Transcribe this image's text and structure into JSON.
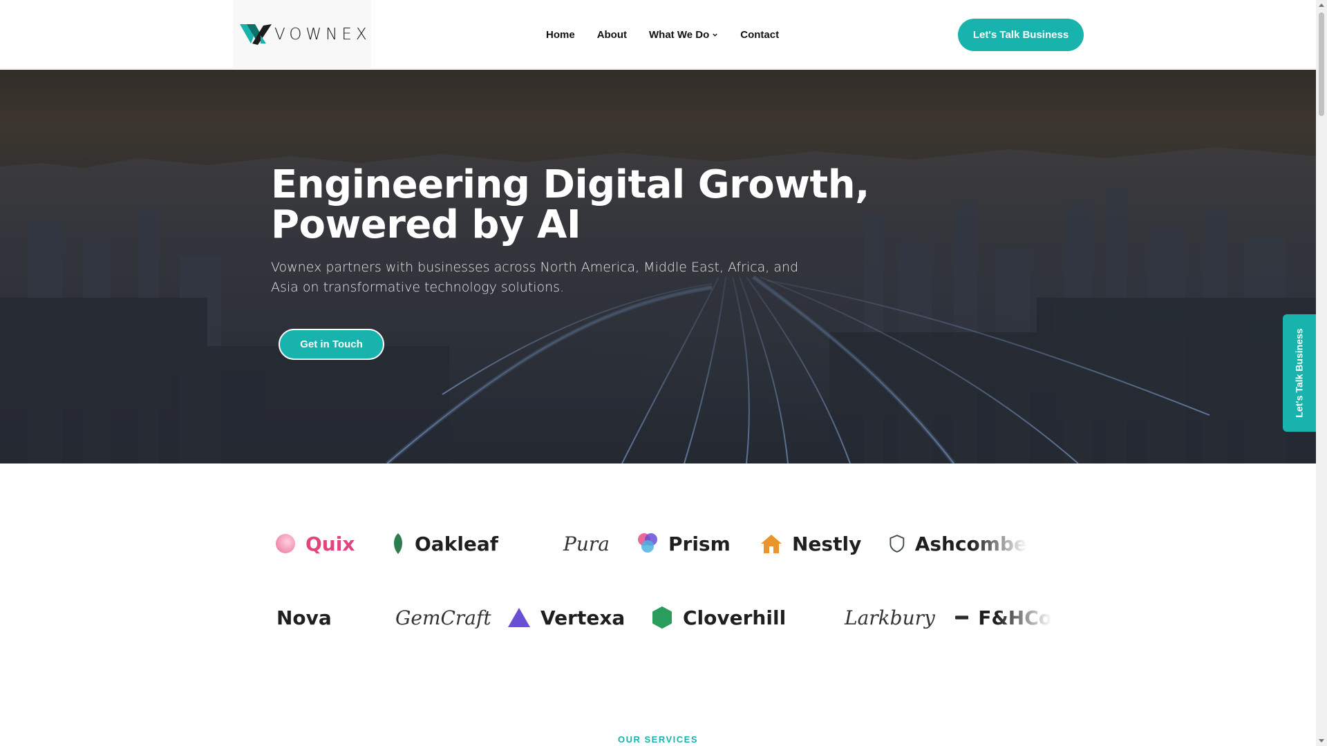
{
  "header": {
    "logo_text": "VOWNEX",
    "nav": [
      {
        "label": "Home"
      },
      {
        "label": "About"
      },
      {
        "label": "What We Do"
      },
      {
        "label": "Contact"
      }
    ],
    "cta_label": "Let's Talk Business"
  },
  "hero": {
    "title_line1": "Engineering Digital Growth,",
    "title_line2": "Powered by AI",
    "subtitle": "Vownex partners with businesses across North America, Middle East, Africa, and Asia on transformative technology solutions.",
    "cta_label": "Get in Touch"
  },
  "side_tab": {
    "label": "Let's Talk Business"
  },
  "logos": {
    "row1": [
      {
        "name": "Quix",
        "icon": "pink-circle-icon"
      },
      {
        "name": "Oakleaf",
        "icon": "leaf-icon"
      },
      {
        "name": "Pura",
        "icon": "none"
      },
      {
        "name": "Prism",
        "icon": "prism-circles-icon"
      },
      {
        "name": "Nestly",
        "icon": "house-icon"
      },
      {
        "name": "Ashcombe",
        "icon": "shield-icon"
      }
    ],
    "row2": [
      {
        "name": "Nova",
        "icon": "none"
      },
      {
        "name": "GemCraft",
        "icon": "none"
      },
      {
        "name": "Vertexa",
        "icon": "triangle-icon"
      },
      {
        "name": "Cloverhill",
        "icon": "hexagon-icon"
      },
      {
        "name": "Larkbury",
        "icon": "none"
      },
      {
        "name": "F&HCo",
        "icon": "bar-icon"
      }
    ]
  },
  "services": {
    "label": "OUR SERVICES"
  },
  "colors": {
    "accent": "#17b3ac",
    "quix": "#e0457b",
    "oakleaf": "#2e7d4f",
    "nestly": "#e8952e",
    "vertexa": "#6a4fd6",
    "cloverhill": "#2a9d5c"
  }
}
